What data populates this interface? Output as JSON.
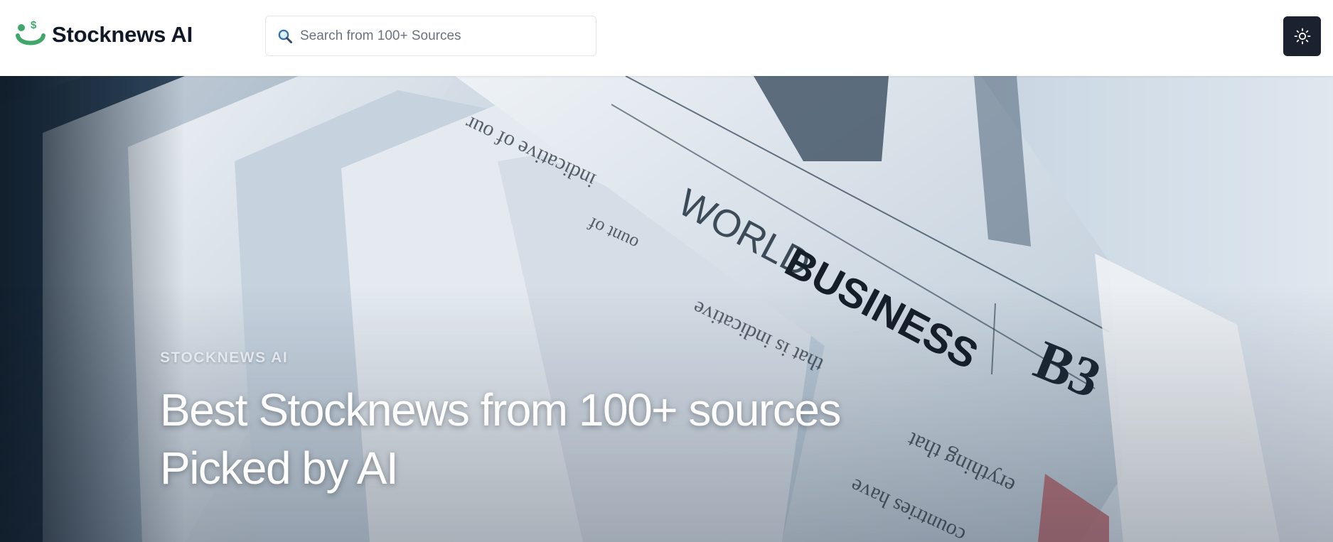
{
  "header": {
    "brand_name": "Stocknews AI",
    "logo_icon": "smile-dollar-icon",
    "search": {
      "placeholder": "Search from 100+ Sources",
      "value": "",
      "icon": "search-icon"
    },
    "theme_toggle_icon": "sun-icon"
  },
  "hero": {
    "eyebrow": "STOCKNEWS AI",
    "headline_line1": "Best Stocknews from 100+ sources",
    "headline_line2": "Picked by AI",
    "image": "newspapers-world-business-photo"
  },
  "colors": {
    "brand_green": "#3fa76a",
    "theme_button_bg": "#1c2130",
    "text_dark": "#111827",
    "hero_text": "#ffffff"
  }
}
